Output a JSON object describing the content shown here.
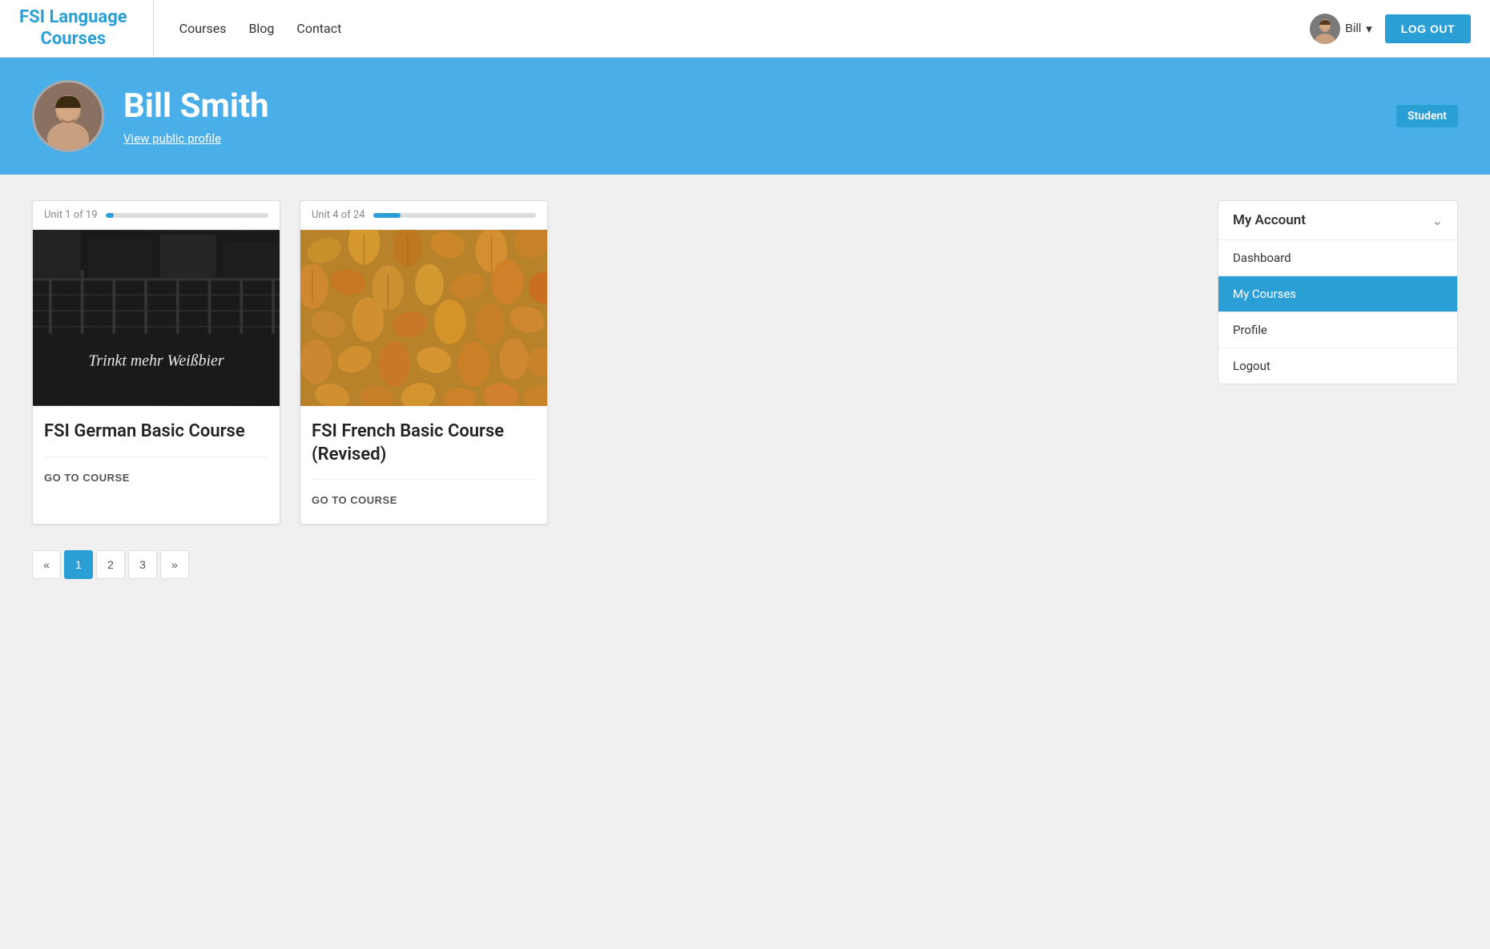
{
  "brand": {
    "line1": "FSI Language",
    "line2": "Courses"
  },
  "navbar": {
    "links": [
      "Courses",
      "Blog",
      "Contact"
    ],
    "user_name": "Bill",
    "logout_label": "LOG OUT"
  },
  "hero": {
    "user_name": "Bill Smith",
    "view_profile_link": "View public profile",
    "badge": "Student"
  },
  "sidebar": {
    "title": "My Account",
    "items": [
      {
        "label": "Dashboard",
        "active": false
      },
      {
        "label": "My Courses",
        "active": true
      },
      {
        "label": "Profile",
        "active": false
      },
      {
        "label": "Logout",
        "active": false
      }
    ]
  },
  "courses": [
    {
      "unit_text": "Unit 1 of 19",
      "progress_percent": 5,
      "title": "FSI German Basic Course",
      "cta": "GO TO COURSE",
      "type": "german"
    },
    {
      "unit_text": "Unit 4 of 24",
      "progress_percent": 17,
      "title": "FSI French Basic Course (Revised)",
      "cta": "GO TO COURSE",
      "type": "french"
    }
  ],
  "pagination": {
    "prev": "«",
    "pages": [
      "1",
      "2",
      "3"
    ],
    "next": "»",
    "active_page": "1"
  }
}
